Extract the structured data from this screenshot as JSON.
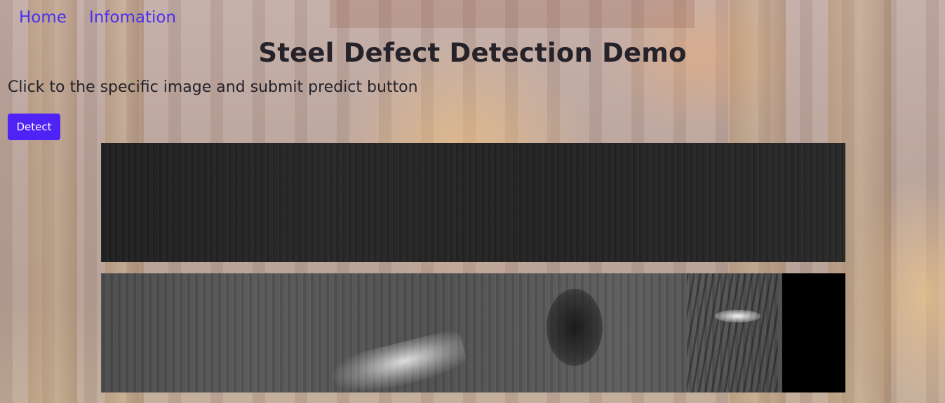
{
  "nav": {
    "items": [
      {
        "label": "Home"
      },
      {
        "label": "Infomation"
      }
    ]
  },
  "header": {
    "title": "Steel Defect Detection Demo"
  },
  "main": {
    "instruction": "Click to the specific image and submit predict button",
    "detect_button_label": "Detect"
  },
  "colors": {
    "link": "#4a30f0",
    "button_bg": "#4f22f5",
    "button_text": "#ffffff",
    "title_text": "#25222a"
  }
}
